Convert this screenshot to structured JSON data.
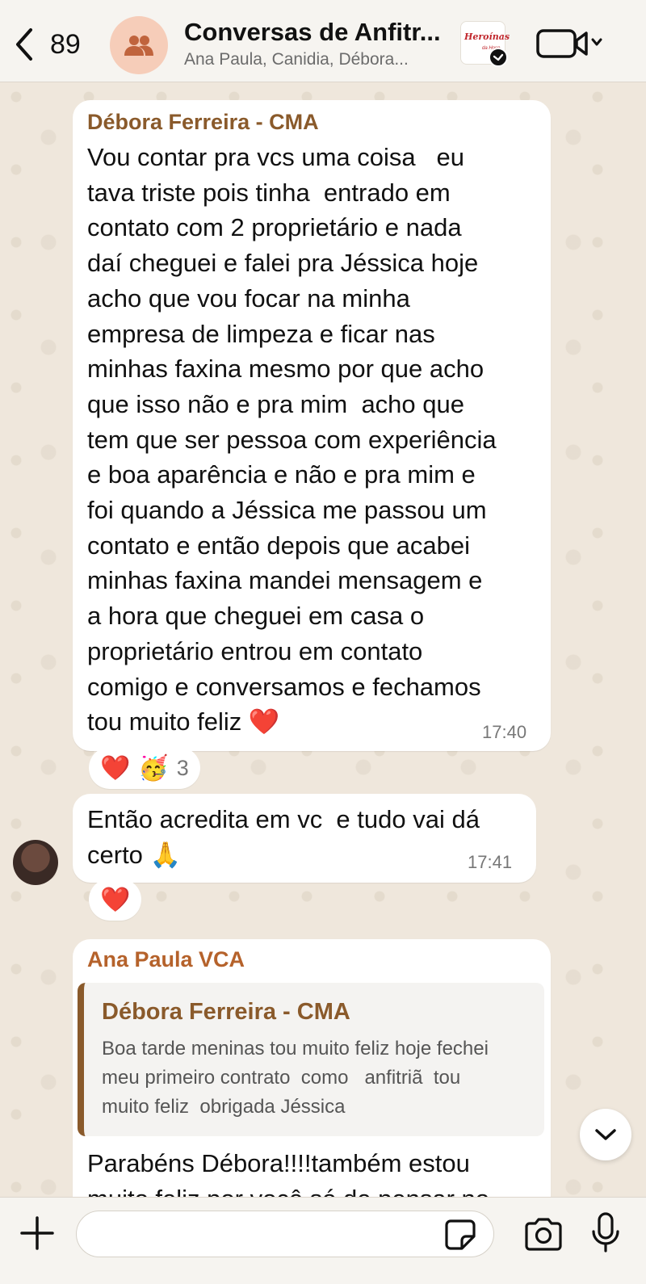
{
  "header": {
    "back_count": "89",
    "title": "Conversas de Anfitr...",
    "subtitle": "Ana Paula, Canidia, Débora...",
    "logo_text": "Heroínas",
    "logo_subtext": "da Hosp"
  },
  "messages": [
    {
      "sender": "Débora Ferreira - CMA",
      "text": "Vou contar pra vcs uma coisa   eu\ntava triste pois tinha  entrado em\ncontato com 2 proprietário e nada\ndaí cheguei e falei pra Jéssica hoje\nacho que vou focar na minha\nempresa de limpeza e ficar nas\nminhas faxina mesmo por que acho\nque isso não e pra mim  acho que\ntem que ser pessoa com experiência\ne boa aparência e não e pra mim e\nfoi quando a Jéssica me passou um\ncontato e então depois que acabei\nminhas faxina mandei mensagem e\na hora que cheguei em casa o\nproprietário entrou em contato\ncomigo e conversamos e fechamos\ntou muito feliz ❤️",
      "time": "17:40",
      "reactions": [
        "❤️",
        "🥳"
      ],
      "reaction_count": "3"
    },
    {
      "sender": "",
      "text": "Então acredita em vc  e tudo vai dá\ncerto 🙏",
      "time": "17:41",
      "reactions": [
        "❤️"
      ]
    },
    {
      "sender": "Ana Paula VCA",
      "quote": {
        "sender": "Débora Ferreira - CMA",
        "text": "Boa tarde meninas tou muito feliz hoje fechei\nmeu primeiro contrato  como   anfitriã  tou\nmuito feliz  obrigada Jéssica"
      },
      "text": "Parabéns Débora!!!!também estou\nmuito feliz por você só de pensar no"
    }
  ],
  "composer": {
    "placeholder": ""
  },
  "colors": {
    "sender_brown": "#8a5a2b",
    "sender_orange": "#b5622b",
    "group_avatar_bg": "#f6cdb9",
    "wallpaper": "#efe7dc"
  },
  "icons": [
    "chevron-left-icon",
    "group-icon",
    "verified-check-icon",
    "video-call-icon",
    "chevron-down-icon",
    "plus-icon",
    "sticker-icon",
    "camera-icon",
    "microphone-icon"
  ]
}
